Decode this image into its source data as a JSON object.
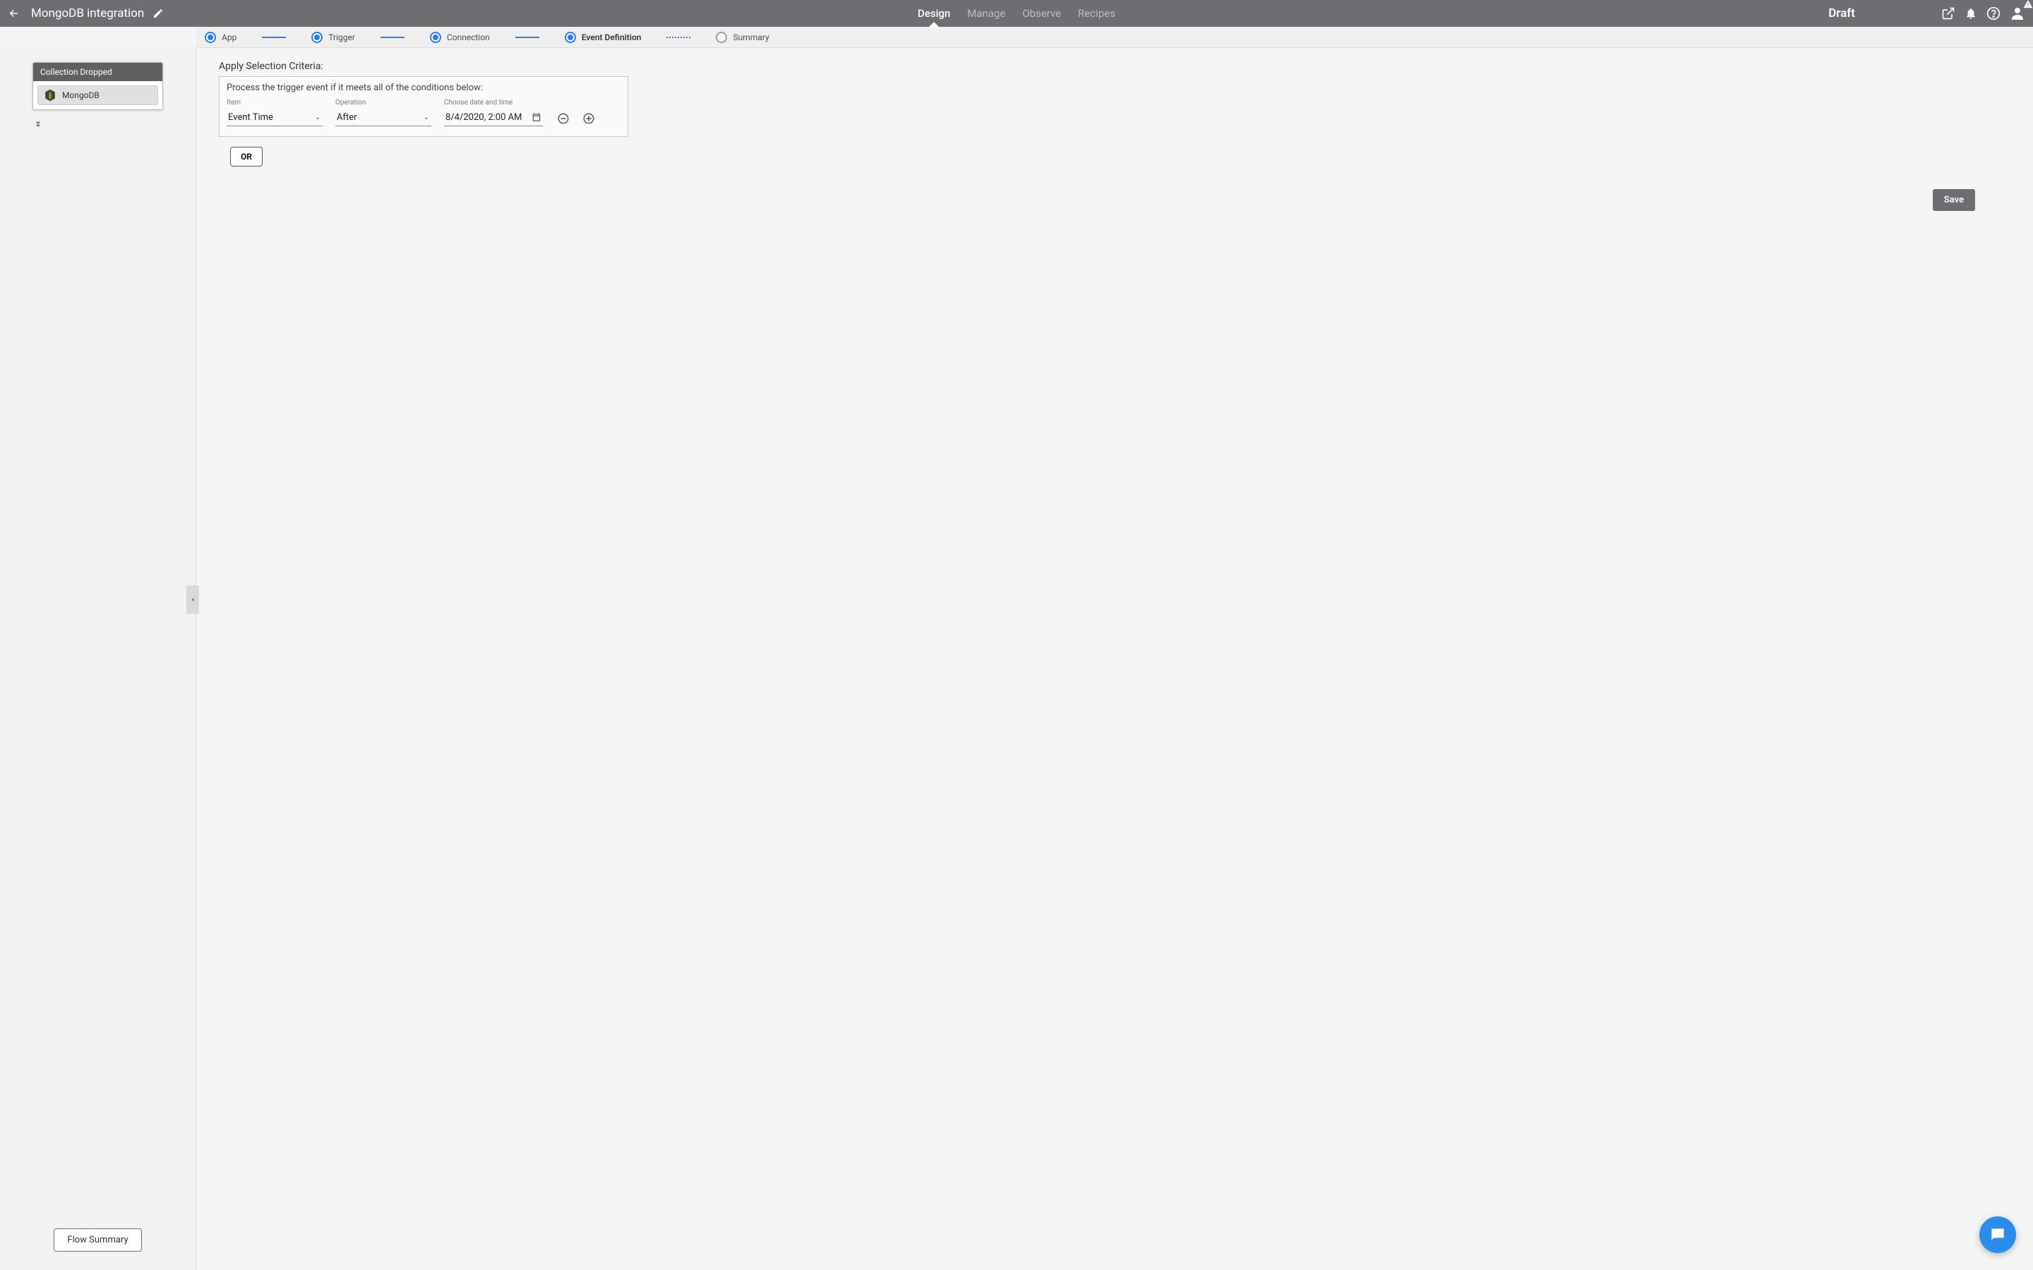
{
  "header": {
    "title": "MongoDB integration",
    "tabs": [
      "Design",
      "Manage",
      "Observe",
      "Recipes"
    ],
    "active_tab": 0,
    "status": "Draft"
  },
  "stepper": {
    "steps": [
      {
        "label": "App",
        "state": "done"
      },
      {
        "label": "Trigger",
        "state": "done"
      },
      {
        "label": "Connection",
        "state": "done"
      },
      {
        "label": "Event Definition",
        "state": "active"
      },
      {
        "label": "Summary",
        "state": "pending"
      }
    ]
  },
  "sidebar": {
    "card_title": "Collection Dropped",
    "connector_name": "MongoDB",
    "flow_summary_label": "Flow Summary"
  },
  "main": {
    "section_title": "Apply Selection Criteria:",
    "criteria_desc": "Process the trigger event if it meets all of the conditions below:",
    "item_label": "Item",
    "item_value": "Event Time",
    "operation_label": "Operation",
    "operation_value": "After",
    "date_label": "Choose date and time",
    "date_value": "8/4/2020, 2:00 AM",
    "or_label": "OR",
    "save_label": "Save"
  },
  "colors": {
    "header_bg": "#6d6e71",
    "accent": "#2b7de9",
    "chat": "#2b8deb"
  }
}
